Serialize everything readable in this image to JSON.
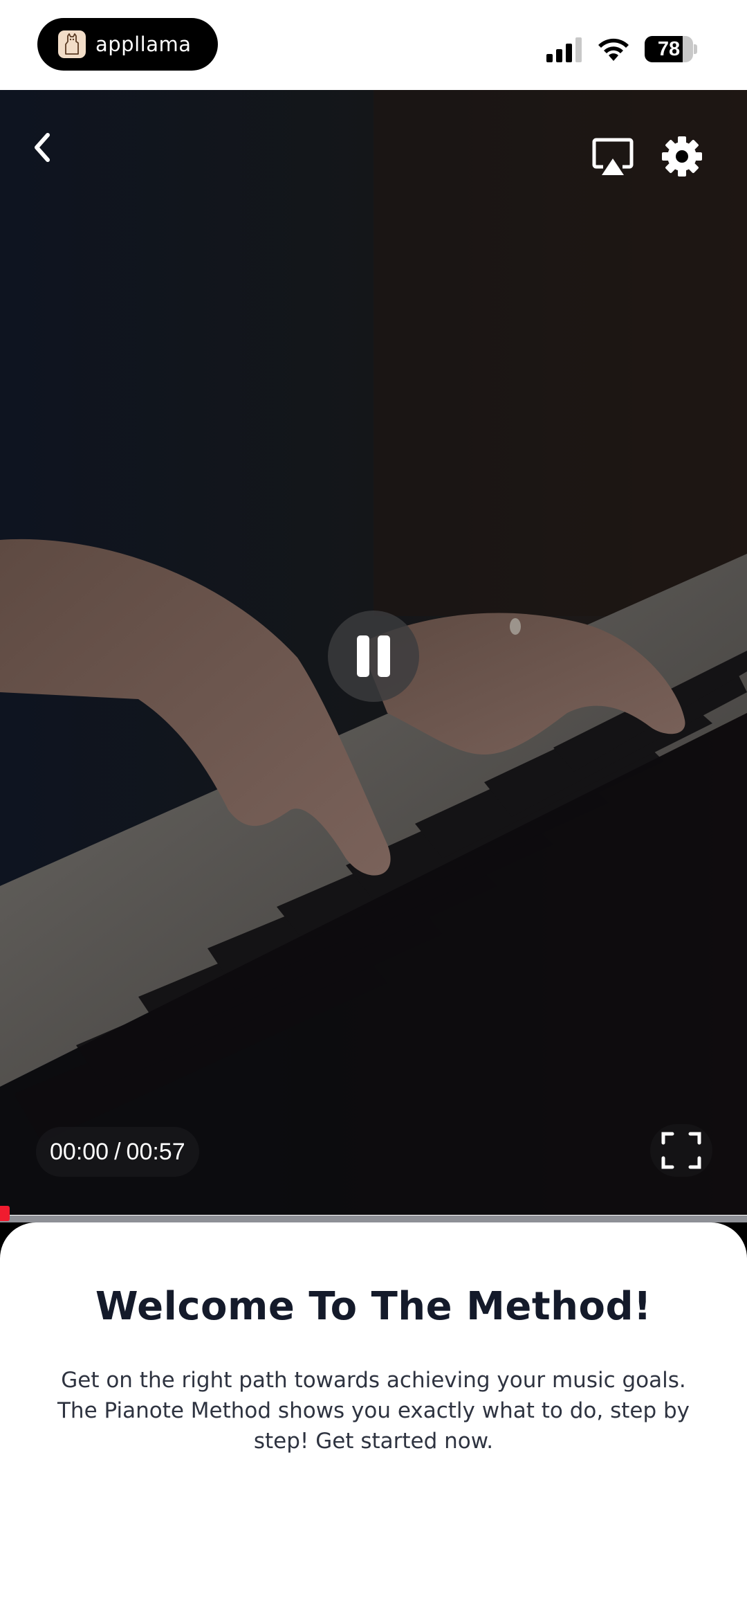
{
  "status_bar": {
    "pill_app_name": "appllama",
    "battery_level": 78,
    "battery_text": "78",
    "signal_icon": "cellular-signal-icon",
    "wifi_icon": "wifi-icon"
  },
  "video": {
    "back_icon": "chevron-left-icon",
    "cast_icon": "airplay-icon",
    "settings_icon": "gear-icon",
    "play_state_icon": "pause-icon",
    "current_time": "00:00",
    "separator": "/",
    "duration": "00:57",
    "fullscreen_icon": "fullscreen-icon",
    "progress_fraction": 0.01,
    "progress_color": "#f01c2f"
  },
  "sheet": {
    "title": "Welcome To The Method!",
    "description": "Get on the right path towards achieving your music goals. The Pianote Method shows you exactly what to do, step by step! Get started now."
  },
  "colors": {
    "title_text": "#141a2a",
    "body_text": "#2e3340",
    "accent": "#f01c2f"
  }
}
